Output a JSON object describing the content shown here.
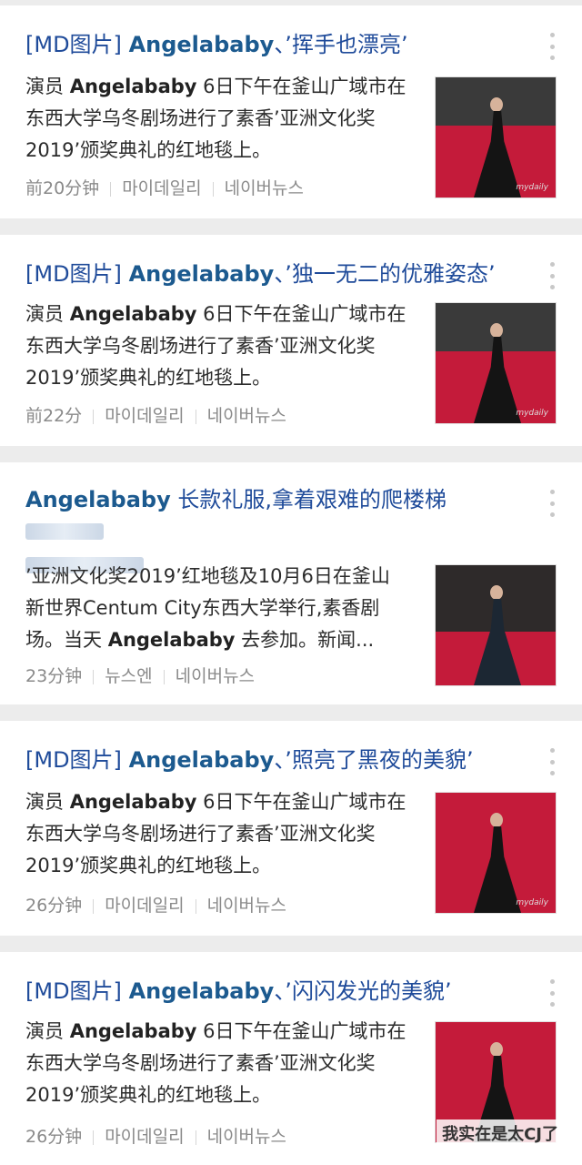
{
  "feed": {
    "items": [
      {
        "title_prefix": "[MD图片]",
        "title_name": "Angelababy",
        "title_rest": "、’挥手也漂亮’",
        "snippet_1": "演员 ",
        "snippet_bold": "Angelababy",
        "snippet_2": " 6日下午在釜山广域市在东西大学乌冬剧场进行了素香’亚洲文化奖2019’颁奖典礼的红地毯上。",
        "time": "前20分钟",
        "source_1": "마이데일리",
        "source_2": "네이버뉴스",
        "thumb_caption": "mydaily"
      },
      {
        "title_prefix": "[MD图片]",
        "title_name": "Angelababy",
        "title_rest": "、’独一无二的优雅姿态’",
        "snippet_1": "演员 ",
        "snippet_bold": "Angelababy",
        "snippet_2": " 6日下午在釜山广域市在东西大学乌冬剧场进行了素香’亚洲文化奖2019’颁奖典礼的红地毯上。",
        "time": "前22分",
        "source_1": "마이데일리",
        "source_2": "네이버뉴스",
        "thumb_caption": "mydaily"
      },
      {
        "title_name": "Angelababy",
        "title_rest": " 长款礼服,拿着艰难的爬楼梯",
        "snippet_1": "’亚洲文化奖2019’红地毯及10月6日在釜山新世界Centum City东西大学举行,素香剧场。当天 ",
        "snippet_bold": "Angelababy",
        "snippet_2": " 去参加。新闻...",
        "time": "23分钟",
        "source_1": "뉴스엔",
        "source_2": "네이버뉴스"
      },
      {
        "title_prefix": "[MD图片]",
        "title_name": "Angelababy",
        "title_rest": "、’照亮了黑夜的美貌’",
        "snippet_1": "演员 ",
        "snippet_bold": "Angelababy",
        "snippet_2": " 6日下午在釜山广域市在东西大学乌冬剧场进行了素香’亚洲文化奖2019’颁奖典礼的红地毯上。",
        "time": "26分钟",
        "source_1": "마이데일리",
        "source_2": "네이버뉴스",
        "thumb_caption": "mydaily"
      },
      {
        "title_prefix": "[MD图片]",
        "title_name": "Angelababy",
        "title_rest": "、’闪闪发光的美貌’",
        "snippet_1": "演员 ",
        "snippet_bold": "Angelababy",
        "snippet_2": " 6日下午在釜山广域市在东西大学乌冬剧场进行了素香’亚洲文化奖2019’颁奖典礼的红地毯上。",
        "time": "26分钟",
        "source_1": "마이데일리",
        "source_2": "네이버뉴스"
      }
    ]
  },
  "watermark": "我实在是太CJ了"
}
